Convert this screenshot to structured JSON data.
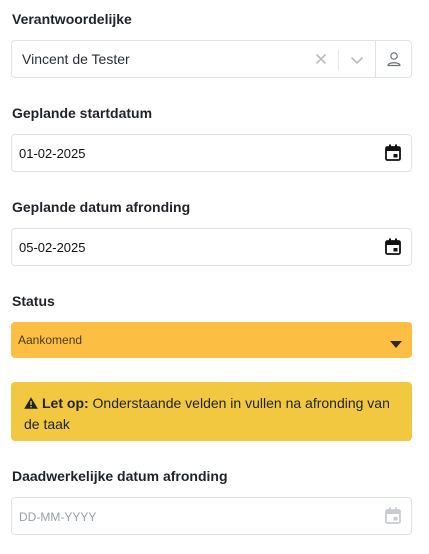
{
  "responsible": {
    "label": "Verantwoordelijke",
    "value": "Vincent de Tester"
  },
  "planned_start": {
    "label": "Geplande startdatum",
    "value": "01-02-2025"
  },
  "planned_end": {
    "label": "Geplande datum afronding",
    "value": "05-02-2025"
  },
  "status": {
    "label": "Status",
    "value": "Aankomend",
    "color": "#fdbf43"
  },
  "warning": {
    "title": "Let op:",
    "text": "Onderstaande velden in vullen na afronding van de taak",
    "color": "#f1c83f",
    "icon": "warning-icon"
  },
  "actual_end": {
    "label": "Daadwerkelijke datum afronding",
    "placeholder": "DD-MM-YYYY"
  }
}
